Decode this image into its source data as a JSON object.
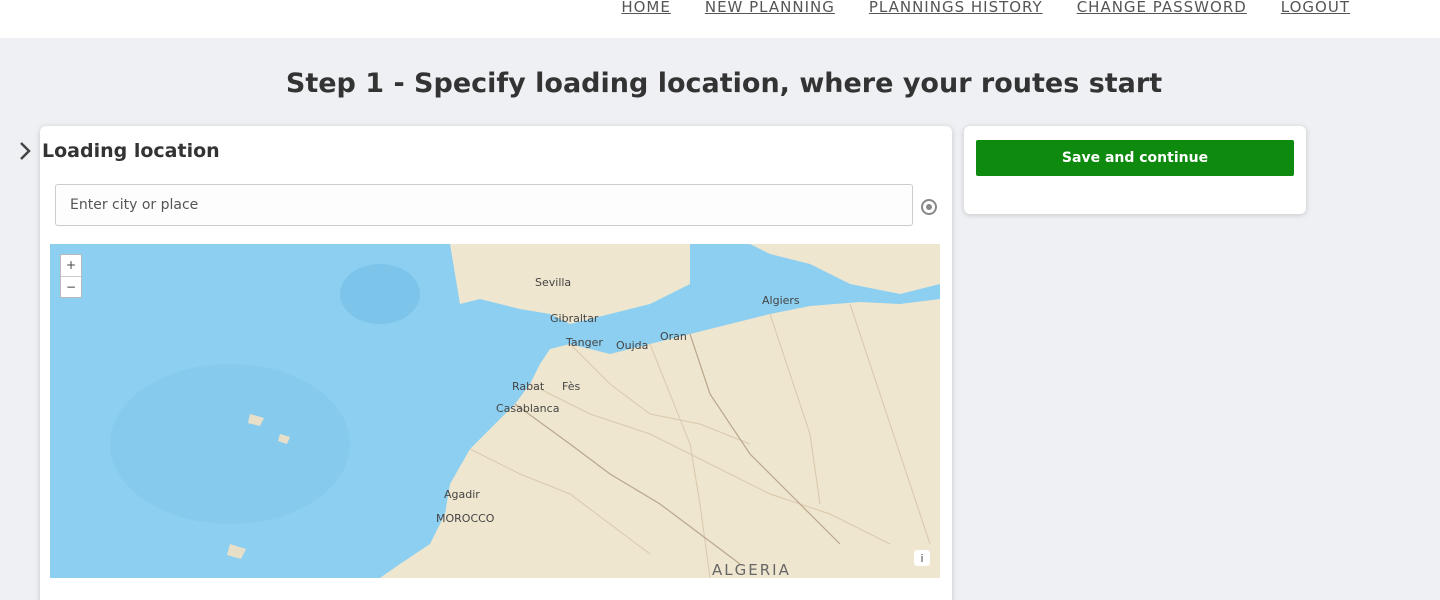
{
  "nav": {
    "items": [
      "HOME",
      "NEW PLANNING",
      "PLANNINGS HISTORY",
      "CHANGE PASSWORD",
      "LOGOUT"
    ]
  },
  "page_title": "Step 1 - Specify loading location, where your routes start",
  "loading_panel": {
    "title": "Loading location",
    "search_placeholder": "Enter city or place"
  },
  "map": {
    "zoom_in": "+",
    "zoom_out": "−",
    "attribution": "i",
    "labels": {
      "algeria": "ALGERIA"
    }
  },
  "actions": {
    "save_label": "Save and continue"
  },
  "colors": {
    "accent_green": "#0e8a0e",
    "water": "#8ccff0",
    "land": "#efe6cf"
  }
}
